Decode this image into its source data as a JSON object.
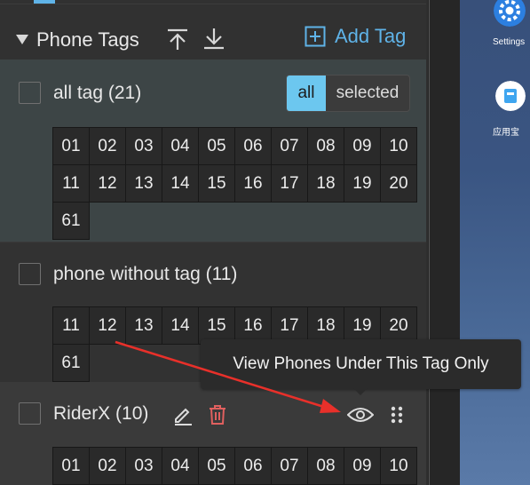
{
  "colors": {
    "accent": "#5fb3e8",
    "segment_active": "#6cc7ef",
    "delete": "#e0605f",
    "annotation": "#e8302a"
  },
  "header": {
    "title": "Phone Tags",
    "add_tag_label": "Add Tag",
    "icons": [
      "collapse-caret-icon",
      "upload-icon",
      "download-icon",
      "add-box-icon"
    ]
  },
  "tags": [
    {
      "label": "all tag (21)",
      "filter": {
        "options": [
          "all",
          "selected"
        ],
        "selected": "all"
      },
      "phones": [
        "01",
        "02",
        "03",
        "04",
        "05",
        "06",
        "07",
        "08",
        "09",
        "10",
        "11",
        "12",
        "13",
        "14",
        "15",
        "16",
        "17",
        "18",
        "19",
        "20",
        "61"
      ]
    },
    {
      "label": "phone without tag (11)",
      "phones": [
        "11",
        "12",
        "13",
        "14",
        "15",
        "16",
        "17",
        "18",
        "19",
        "20",
        "61"
      ]
    },
    {
      "label": "RiderX (10)",
      "icons": [
        "edit-icon",
        "delete-icon",
        "eye-icon",
        "drag-handle-icon"
      ],
      "phones": [
        "01",
        "02",
        "03",
        "04",
        "05",
        "06",
        "07",
        "08",
        "09",
        "10"
      ]
    }
  ],
  "tooltip": {
    "text": "View Phones Under This Tag Only"
  },
  "device_screen": {
    "apps": [
      {
        "label": "Settings",
        "icon": "gear-icon"
      },
      {
        "label": "应用宝",
        "icon": "app-store-icon"
      }
    ]
  }
}
